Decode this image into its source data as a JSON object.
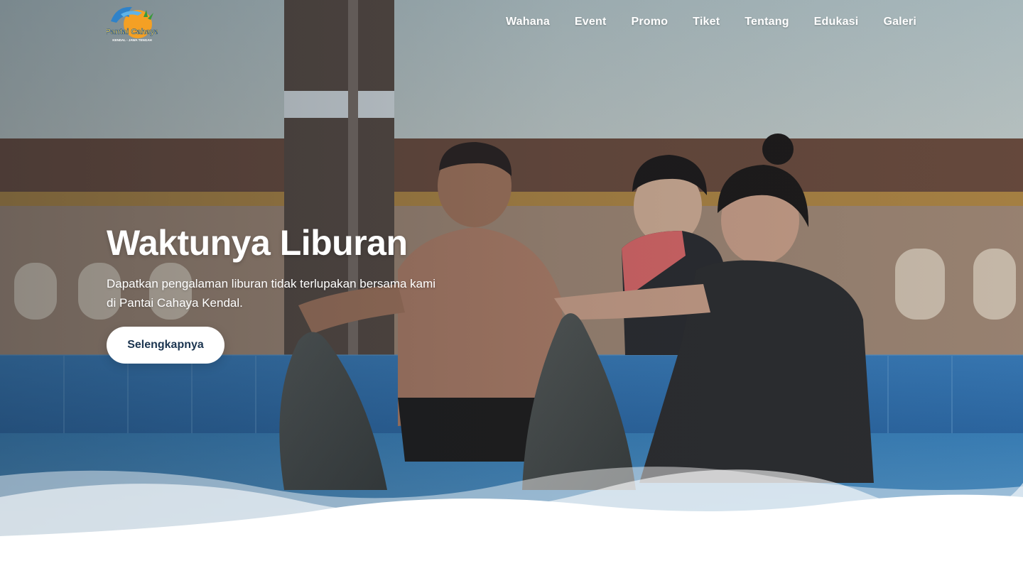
{
  "brand": {
    "logo_text": "Pantai Cahaya",
    "logo_subtext": "KENDAL - JAWA TENGAH"
  },
  "nav": {
    "items": [
      {
        "label": "Wahana"
      },
      {
        "label": "Event"
      },
      {
        "label": "Promo"
      },
      {
        "label": "Tiket"
      },
      {
        "label": "Tentang"
      },
      {
        "label": "Edukasi"
      },
      {
        "label": "Galeri"
      }
    ]
  },
  "hero": {
    "title": "Waktunya Liburan",
    "subtitle": "Dapatkan pengalaman liburan tidak terlupakan bersama kami di Pantai Cahaya Kendal.",
    "cta_label": "Selengkapnya"
  },
  "colors": {
    "cta_text": "#1c3550",
    "pool_blue": "#2f74b5",
    "wave_white": "#ffffff"
  }
}
